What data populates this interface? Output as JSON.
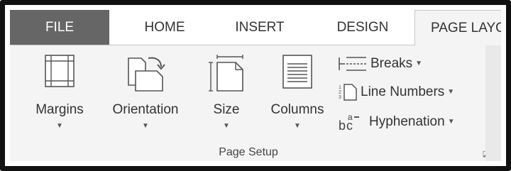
{
  "tabs": {
    "file": "FILE",
    "home": "HOME",
    "insert": "INSERT",
    "design": "DESIGN",
    "page_layout": "PAGE LAYO"
  },
  "page_setup": {
    "margins": {
      "label": "Margins",
      "icon": "margins-icon"
    },
    "orientation": {
      "label": "Orientation",
      "icon": "orientation-icon"
    },
    "size": {
      "label": "Size",
      "icon": "size-icon"
    },
    "columns": {
      "label": "Columns",
      "icon": "columns-icon"
    },
    "breaks": {
      "label": "Breaks",
      "icon": "breaks-icon"
    },
    "line_numbers": {
      "label": "Line Numbers",
      "icon": "line-numbers-icon"
    },
    "hyphenation": {
      "label": "Hyphenation",
      "icon": "hyphenation-icon"
    },
    "group_label": "Page Setup"
  },
  "colors": {
    "file_tab_bg": "#666666",
    "ribbon_bg": "#f4f4f4",
    "frame_border": "#111111"
  }
}
